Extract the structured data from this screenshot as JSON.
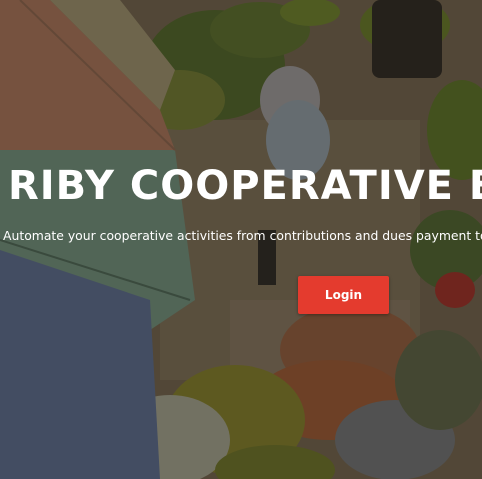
{
  "hero": {
    "title": "RIBY COOPERATIVE E",
    "subtitle": "Automate your cooperative activities from contributions and dues payment to lo",
    "login_label": "Login"
  },
  "colors": {
    "accent": "#e43b2e",
    "text": "#ffffff",
    "overlay": "#1c1814"
  }
}
